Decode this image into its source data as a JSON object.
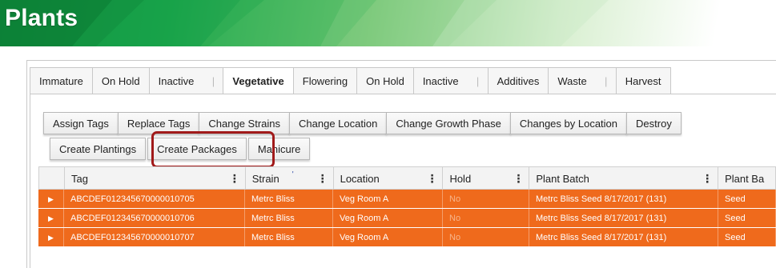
{
  "page": {
    "title": "Plants"
  },
  "tabs": [
    {
      "label": "Immature",
      "active": false
    },
    {
      "label": "On Hold",
      "active": false
    },
    {
      "label": "Inactive",
      "active": false
    },
    {
      "label": "Vegetative",
      "active": true
    },
    {
      "label": "Flowering",
      "active": false
    },
    {
      "label": "On Hold",
      "active": false
    },
    {
      "label": "Inactive",
      "active": false
    },
    {
      "label": "Additives",
      "active": false
    },
    {
      "label": "Waste",
      "active": false
    },
    {
      "label": "Harvest",
      "active": false
    }
  ],
  "toolbar": {
    "row1": [
      "Assign Tags",
      "Replace Tags",
      "Change Strains",
      "Change Location",
      "Change Growth Phase",
      "Changes by Location",
      "Destroy"
    ],
    "row2": [
      "Create Plantings",
      "Create Packages",
      "Manicure"
    ]
  },
  "grid": {
    "columns": [
      "Tag",
      "Strain",
      "Location",
      "Hold",
      "Plant Batch",
      "Plant Ba"
    ],
    "rows": [
      {
        "tag": "ABCDEF012345670000010705",
        "strain": "Metrc Bliss",
        "location": "Veg Room A",
        "hold": "No",
        "plant_batch": "Metrc Bliss Seed 8/17/2017 (131)",
        "plant_batch_type": "Seed"
      },
      {
        "tag": "ABCDEF012345670000010706",
        "strain": "Metrc Bliss",
        "location": "Veg Room A",
        "hold": "No",
        "plant_batch": "Metrc Bliss Seed 8/17/2017 (131)",
        "plant_batch_type": "Seed"
      },
      {
        "tag": "ABCDEF012345670000010707",
        "strain": "Metrc Bliss",
        "location": "Veg Room A",
        "hold": "No",
        "plant_batch": "Metrc Bliss Seed 8/17/2017 (131)",
        "plant_batch_type": "Seed"
      }
    ],
    "row_color": "#ef6a1c"
  },
  "icons": {
    "expander": "triangle-right-icon",
    "column_menu": "vertical-ellipsis-icon"
  }
}
